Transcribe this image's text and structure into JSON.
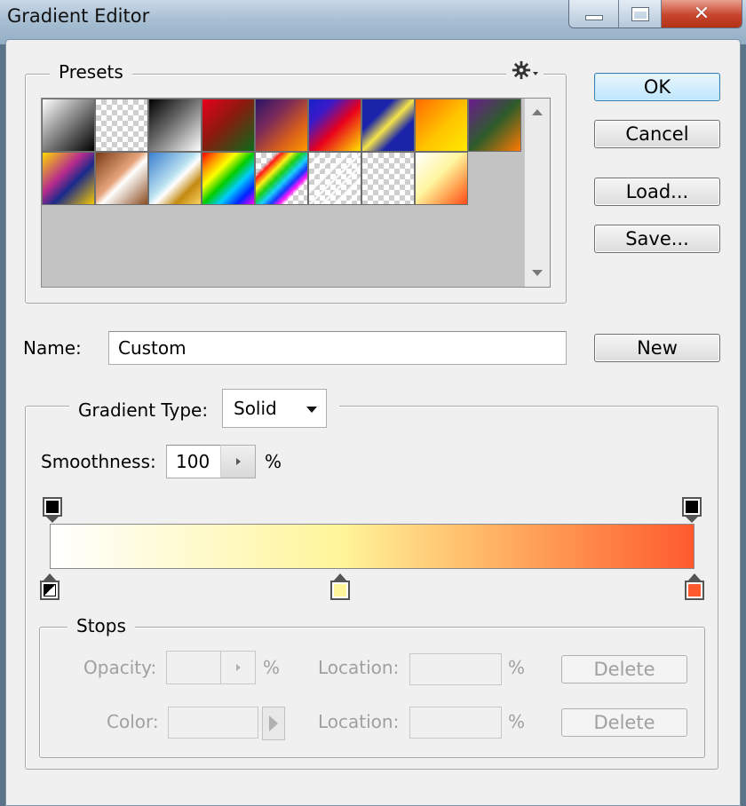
{
  "window": {
    "title": "Gradient Editor",
    "min_glyph": "",
    "max_glyph": "",
    "close_glyph": "✕"
  },
  "presets": {
    "legend": "Presets",
    "menu_icon": "gear-icon",
    "swatches": [
      {
        "style": "linear-gradient(135deg,#ffffff 0%,#8c8c8c 45%,#000000 100%)"
      },
      {
        "style": "checker-white"
      },
      {
        "style": "linear-gradient(135deg,#000000 0%,#777777 50%,#ffffff 100%)"
      },
      {
        "style": "linear-gradient(135deg,#e8001c 0%,#8a1a0e 45%,#0b6b1b 100%)"
      },
      {
        "style": "linear-gradient(135deg,#2a1468 0%,#7b2a5a 35%,#d8601a 70%,#ff9a00 100%)"
      },
      {
        "style": "linear-gradient(135deg,#1522c8 0%,#3b1ac8 25%,#e8001c 55%,#ffe600 100%)"
      },
      {
        "style": "linear-gradient(135deg,#1a24a8 0%,#1a24a8 30%,#f5e44a 50%,#1a24a8 70%,#1a24a8 100%)"
      },
      {
        "style": "linear-gradient(135deg,#ff6a00 0%,#ffc400 55%,#ffea00 100%)"
      },
      {
        "style": "linear-gradient(135deg,#6a1b8e 0%,#2d5c2a 50%,#ff7a00 100%)"
      },
      {
        "style": "linear-gradient(135deg,#ffd800 0%,#b52a8e 40%,#1a2a8a 60%,#f5c800 100%)"
      },
      {
        "style": "linear-gradient(135deg,#7a3a15 0%,#e6a57a 45%,#ffffff 55%,#8a4a1e 100%)"
      },
      {
        "style": "linear-gradient(135deg,#3a7fd0 0%,#b8e0f0 45%,#ffffff 55%,#c48a10 75%,#f8d060 100%)"
      },
      {
        "style": "linear-gradient(135deg,#ff0000 0%,#ff8800 16%,#ffff00 33%,#00cc00 50%,#00ccff 66%,#0022ff 83%,#ff00ff 100%)"
      },
      {
        "style": "checker-rainbow"
      },
      {
        "style": "checker-stripes"
      },
      {
        "style": "checker-plain"
      },
      {
        "style": "linear-gradient(135deg,#ffffff 0%,#fff6a0 45%,#ff9a4a 75%,#ff4a1a 100%)"
      }
    ]
  },
  "buttons": {
    "ok": "OK",
    "cancel": "Cancel",
    "load": "Load...",
    "save": "Save...",
    "new": "New"
  },
  "name": {
    "label": "Name:",
    "value": "Custom"
  },
  "gradient": {
    "type_label": "Gradient Type:",
    "type_value": "Solid",
    "smoothness_label": "Smoothness:",
    "smoothness_value": "100",
    "smoothness_unit": "%",
    "colors": {
      "start": "#ffffff",
      "mid": "#fff59a",
      "end": "#ff5a2e"
    },
    "color_stops": [
      {
        "location": 0,
        "color": "#000000",
        "selected": true
      },
      {
        "location": 0.45,
        "color": "#fff59a"
      },
      {
        "location": 1,
        "color": "#ff5a2e"
      }
    ]
  },
  "stops": {
    "legend": "Stops",
    "opacity_label": "Opacity:",
    "opacity_unit": "%",
    "location_label": "Location:",
    "location_unit": "%",
    "color_label": "Color:",
    "delete_label": "Delete"
  }
}
